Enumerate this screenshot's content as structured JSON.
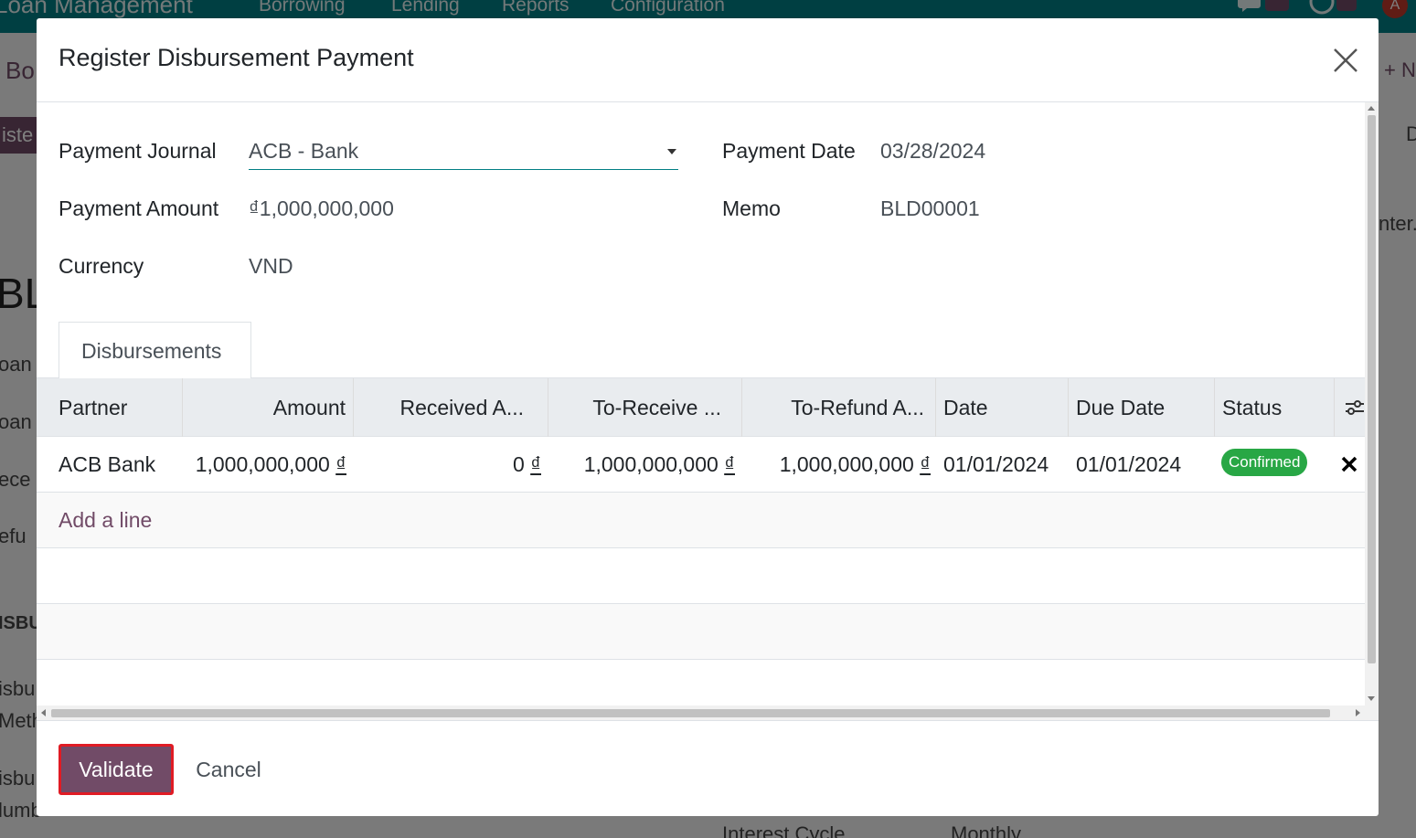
{
  "background": {
    "app_title": "Loan Management",
    "menu": [
      "Borrowing",
      "Lending",
      "Reports",
      "Configuration"
    ],
    "avatar_letter": "A",
    "fragments": {
      "breadcrumb": "Bo",
      "chip": "iste",
      "new_btn": "+ N",
      "record_name": "BL",
      "right_label": "D",
      "right_text": "nter.",
      "label1": "oan",
      "label2": "oan",
      "label3": "ece",
      "label4": "efu",
      "section": "ISBU",
      "label5": "isbu",
      "label6": "Meth",
      "label7": "isbu",
      "label8": "lumb",
      "interest_cycle_label": "Interest Cycle",
      "interest_cycle_value": "Monthly"
    }
  },
  "dialog": {
    "title": "Register Disbursement Payment",
    "fields": {
      "payment_journal_label": "Payment Journal",
      "payment_journal_value": "ACB - Bank",
      "payment_date_label": "Payment Date",
      "payment_date_value": "03/28/2024",
      "payment_amount_label": "Payment Amount",
      "payment_amount_value": "₫1,000,000,000",
      "memo_label": "Memo",
      "memo_value": "BLD00001",
      "currency_label": "Currency",
      "currency_value": "VND"
    },
    "tab_label": "Disbursements",
    "table": {
      "columns": [
        "Partner",
        "Amount",
        "Received A...",
        "To-Receive ...",
        "To-Refund A...",
        "Date",
        "Due Date",
        "Status"
      ],
      "row": {
        "partner": "ACB Bank",
        "amount": "1,000,000,000",
        "received": "0",
        "to_receive": "1,000,000,000",
        "to_refund": "1,000,000,000",
        "currency_symbol": "₫",
        "date": "01/01/2024",
        "due_date": "01/01/2024",
        "status": "Confirmed"
      },
      "add_line": "Add a line"
    },
    "footer": {
      "validate": "Validate",
      "cancel": "Cancel"
    }
  },
  "colors": {
    "brand": "#714b67",
    "topbar": "#017e84",
    "status_confirmed": "#28a745",
    "highlight": "#e01b24"
  }
}
